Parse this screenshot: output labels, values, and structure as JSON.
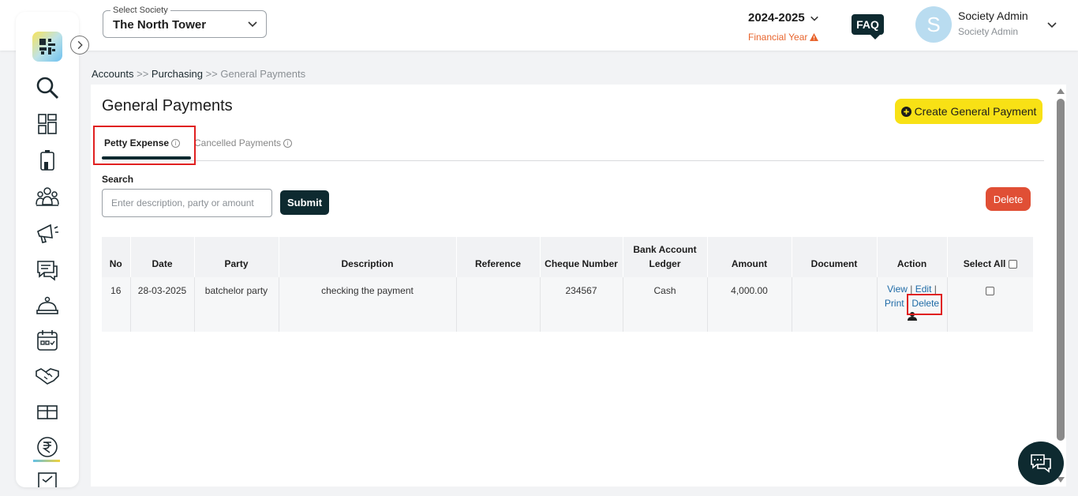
{
  "header": {
    "society_label": "Select Society",
    "society_value": "The North Tower",
    "financial_year": "2024-2025",
    "financial_year_label": "Financial Year",
    "faq_label": "FAQ",
    "avatar_initial": "S",
    "user_name": "Society Admin",
    "user_role": "Society Admin"
  },
  "sidebar": {
    "icons": [
      "logo-icon",
      "search-icon",
      "dashboard-icon",
      "building-icon",
      "members-icon",
      "announcement-icon",
      "chat-icon",
      "service-icon",
      "calendar-icon",
      "handshake-icon",
      "facility-icon",
      "rupee-icon",
      "checklist-icon"
    ]
  },
  "breadcrumb": {
    "accounts": "Accounts",
    "sep1": ">>",
    "purchasing": "Purchasing",
    "sep2": ">>",
    "current": "General Payments"
  },
  "page": {
    "title": "General Payments",
    "create_button": "Create General Payment",
    "tabs": [
      {
        "label": "Petty Expense",
        "active": true
      },
      {
        "label": "Cancelled Payments",
        "active": false
      }
    ],
    "search_label": "Search",
    "search_placeholder": "Enter description, party or amount",
    "submit_label": "Submit",
    "delete_label": "Delete"
  },
  "table": {
    "headers": [
      "No",
      "Date",
      "Party",
      "Description",
      "Reference",
      "Cheque Number",
      "Bank Account Ledger",
      "Amount",
      "Document",
      "Action",
      "Select All"
    ],
    "rows": [
      {
        "no": "16",
        "date": "28-03-2025",
        "party": "batchelor party",
        "description": "checking the payment",
        "reference": "",
        "cheque_number": "234567",
        "bank_account_ledger": "Cash",
        "amount": "4,000.00",
        "document": "",
        "actions": {
          "view": "View",
          "edit": "Edit",
          "print": "Print",
          "delete": "Delete",
          "sep": "|"
        }
      }
    ]
  },
  "colors": {
    "accent_dark": "#0e2a30",
    "create_button": "#f8e115",
    "delete_button": "#e04f35",
    "highlight": "#e02020",
    "link": "#1d6aa6",
    "warning": "#e8652e"
  }
}
